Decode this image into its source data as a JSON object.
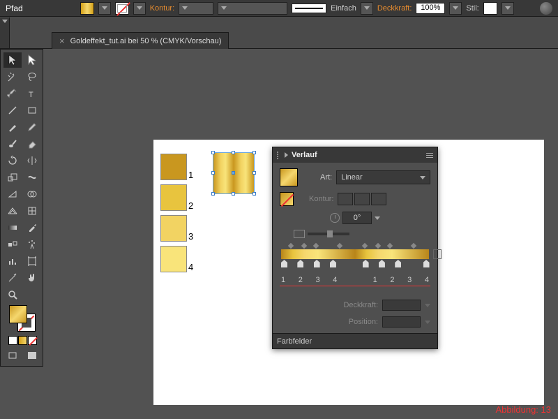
{
  "topbar": {
    "mode": "Pfad",
    "kontur_label": "Kontur:",
    "stroke_style": "Einfach",
    "opacity_label": "Deckkraft:",
    "opacity_value": "100%",
    "style_label": "Stil:"
  },
  "document": {
    "tab_title": "Goldeffekt_tut.ai bei 50 % (CMYK/Vorschau)"
  },
  "swatches": {
    "labels": [
      "1",
      "2",
      "3",
      "4"
    ]
  },
  "gradient_panel": {
    "title": "Verlauf",
    "art_label": "Art:",
    "type_value": "Linear",
    "kontur_label": "Kontur:",
    "angle_value": "0°",
    "stop_numbers": [
      "1",
      "2",
      "3",
      "4",
      "1",
      "2",
      "3",
      "4"
    ],
    "opacity_label": "Deckkraft:",
    "position_label": "Position:"
  },
  "swatch_panel": {
    "title": "Farbfelder"
  },
  "caption": "Abbildung: 13"
}
